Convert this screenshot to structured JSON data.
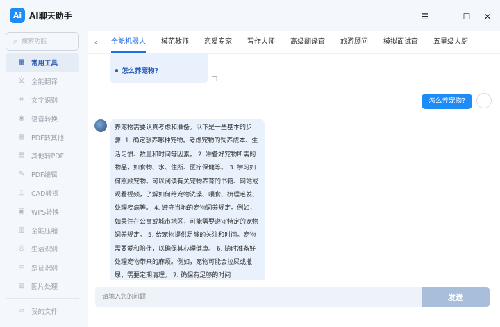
{
  "app": {
    "logo_text": "Ai",
    "title": "AI聊天助手"
  },
  "search": {
    "placeholder": "搜索功能"
  },
  "nav": [
    {
      "label": "常用工具",
      "icon": "grid-icon",
      "glyph": "▦",
      "active": true
    },
    {
      "label": "全能翻译",
      "icon": "translate-icon",
      "glyph": "文"
    },
    {
      "label": "文字识别",
      "icon": "text-scan-icon",
      "glyph": "⌗"
    },
    {
      "label": "语音转换",
      "icon": "audio-icon",
      "glyph": "◉"
    },
    {
      "label": "PDF转其他",
      "icon": "pdf-icon",
      "glyph": "▤"
    },
    {
      "label": "其他转PDF",
      "icon": "file-convert-icon",
      "glyph": "▤"
    },
    {
      "label": "PDF编辑",
      "icon": "pdf-edit-icon",
      "glyph": "✎"
    },
    {
      "label": "CAD转换",
      "icon": "cad-icon",
      "glyph": "◫"
    },
    {
      "label": "WPS转换",
      "icon": "wps-icon",
      "glyph": "▣"
    },
    {
      "label": "全能压缩",
      "icon": "compress-icon",
      "glyph": "▥"
    },
    {
      "label": "生活识别",
      "icon": "life-scan-icon",
      "glyph": "◎"
    },
    {
      "label": "票证识别",
      "icon": "ticket-icon",
      "glyph": "▭"
    },
    {
      "label": "图片处理",
      "icon": "image-icon",
      "glyph": "▨"
    }
  ],
  "nav_bottom": {
    "label": "我的文件",
    "icon": "folder-icon",
    "glyph": "▱"
  },
  "window": {
    "menu": "☰",
    "minimize": "—",
    "maximize": "☐",
    "close": "✕"
  },
  "tabs": [
    "全能机器人",
    "模范教师",
    "恋爱专家",
    "写作大师",
    "高级翻译官",
    "旅游顾问",
    "模拟面试官",
    "五星级大厨"
  ],
  "tab_arrow": "‹",
  "chat": {
    "prev_question": "怎么养宠物?",
    "user_message": "怎么养宠物?",
    "bot_reply": "养宠物需要认真考虑和准备。以下是一些基本的步骤: 1. 确定想养哪种宠物。考虑宠物的饲养成本、生活习惯、数量和时间等因素。 2. 准备好宠物所需的物品，如食物、水、住所、医疗保健等。 3. 学习如何照顾宠物。可以阅读有关宠物养育的书籍、网站或观看视频，了解如何给宠物洗澡、喂食、梳理毛发、处理疾病等。 4. 遵守当地的宠物饲养规定。例如，如果住在公寓或城市地区，可能需要遵守特定的宠物饲养规定。 5. 给宠物提供足够的关注和时间。宠物需要爱和陪伴，以确保其心理健康。 6. 随时准备好处理宠物带来的麻烦。例如，宠物可能会拉屎或撒尿，需要定期清理。 7. 确保有足够的时间"
  },
  "composer": {
    "placeholder": "请输入您的问题",
    "send_label": "发送"
  },
  "colors": {
    "accent": "#1e8cf6",
    "send_disabled": "#a9bedb",
    "bubble": "#e9f1fc"
  }
}
